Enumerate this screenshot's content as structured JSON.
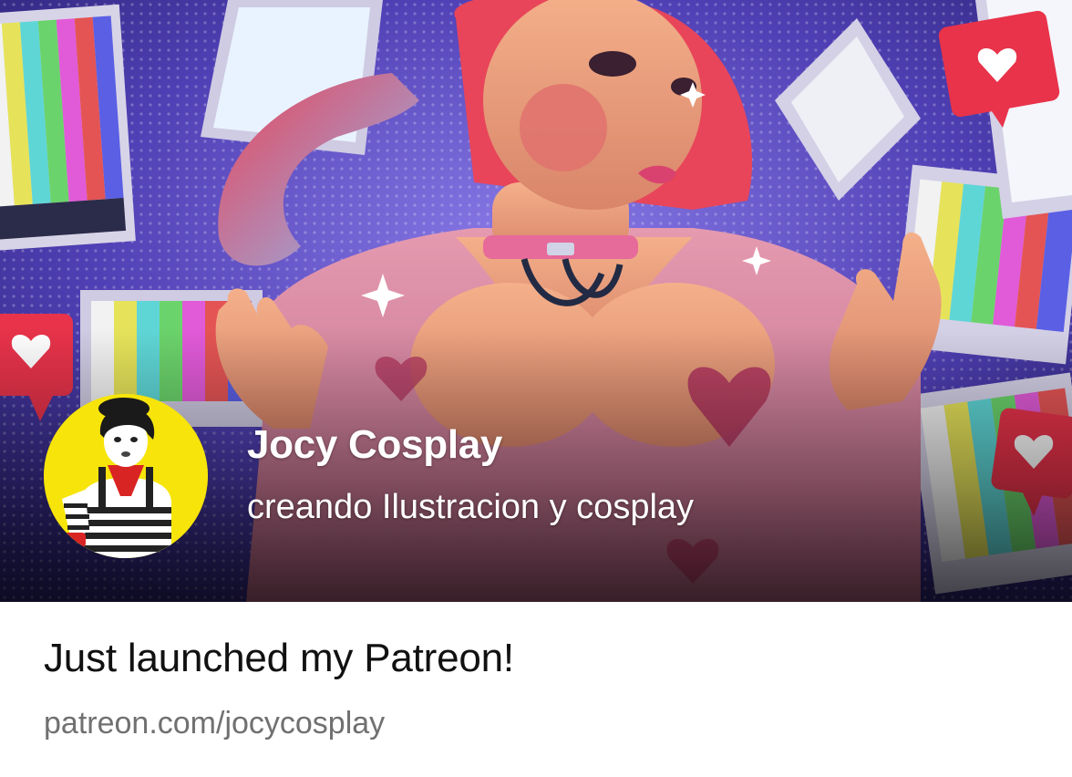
{
  "creator": {
    "name": "Jocy Cosplay",
    "tagline": "creando Ilustracion y cosplay"
  },
  "post": {
    "title": "Just launched my Patreon!",
    "url": "patreon.com/jocycosplay"
  },
  "colors": {
    "banner_bg": "#4a3aa8",
    "avatar_bg": "#f6e40a",
    "heart_red": "#e8334a",
    "title_text": "#111111",
    "url_text": "#707070"
  },
  "icons": {
    "banner_decor": "heart-bubble-icon"
  }
}
